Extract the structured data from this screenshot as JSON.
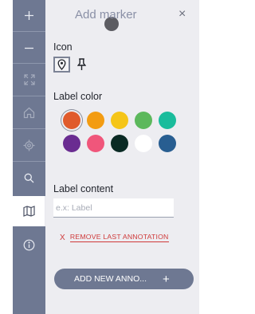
{
  "rail": {
    "zoom_in": "+",
    "zoom_out": "−",
    "icons": [
      "plus-icon",
      "minus-icon",
      "fullscreen-icon",
      "home-icon",
      "locate-icon",
      "search-icon",
      "map-icon",
      "info-icon"
    ]
  },
  "panel": {
    "title": "Add marker",
    "close": "×",
    "icon_label": "Icon",
    "icons": [
      "map-pin-icon",
      "pushpin-icon"
    ],
    "color_label": "Label color",
    "colors": [
      "#e05a2b",
      "#f39c12",
      "#f5c518",
      "#5cb85c",
      "#1abc9c",
      "#6a2c91",
      "#f0567b",
      "#0a2a24",
      "#ffffff",
      "#285e91"
    ],
    "selected_color": "#e05a2b",
    "content_label": "Label content",
    "content_placeholder": "e.x: Label",
    "content_value": "",
    "remove_x": "X",
    "remove_label": "REMOVE LAST ANNOTATION",
    "add_label": "ADD NEW ANNO...",
    "add_plus": "+"
  }
}
